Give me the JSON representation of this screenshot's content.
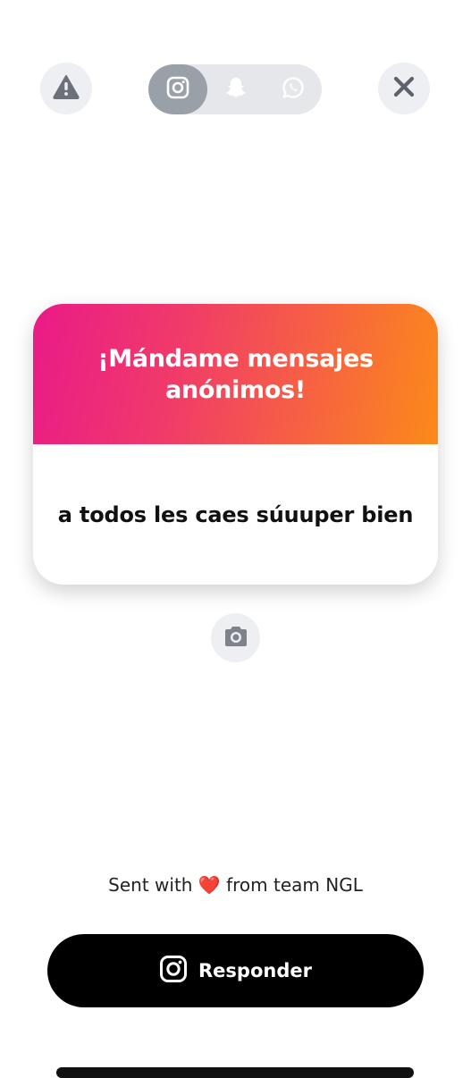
{
  "header": {
    "report_icon": "warning-triangle-icon",
    "close_icon": "close-icon",
    "share_targets": [
      {
        "name": "instagram",
        "icon": "instagram-icon",
        "active": true
      },
      {
        "name": "snapchat",
        "icon": "snapchat-ghost-icon",
        "active": false
      },
      {
        "name": "whatsapp",
        "icon": "whatsapp-icon",
        "active": false
      }
    ]
  },
  "card": {
    "title": "¡Mándame mensajes anónimos!",
    "message": "a todos les caes súuuper bien",
    "gradient_colors": [
      "#ea1a88",
      "#fb8a1a"
    ]
  },
  "camera_icon": "camera-icon",
  "footer": {
    "prefix": "Sent with",
    "heart": "❤️",
    "suffix": "from team NGL"
  },
  "reply_button": {
    "label": "Responder",
    "icon": "instagram-icon"
  }
}
